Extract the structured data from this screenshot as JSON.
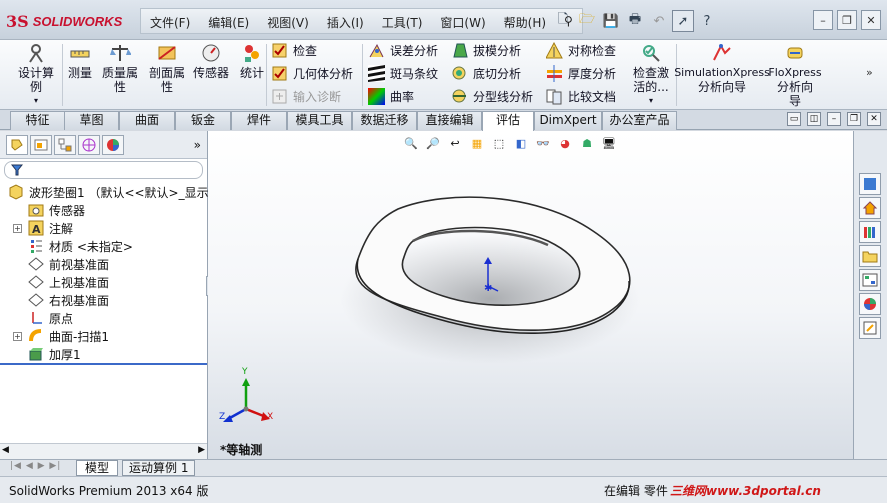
{
  "app": {
    "brand_ds": "3S",
    "brand_name": "SOLIDWORKS"
  },
  "menubar": {
    "items": [
      "文件(F)",
      "编辑(E)",
      "视图(V)",
      "插入(I)",
      "工具(T)",
      "窗口(W)",
      "帮助(H)"
    ]
  },
  "quick_access": {
    "help_symbol": "?"
  },
  "ribbon": {
    "design_study": [
      "设计算",
      "例"
    ],
    "measure": "测量",
    "mass_props": [
      "质量属",
      "性"
    ],
    "section_props": [
      "剖面属",
      "性"
    ],
    "sensor": "传感器",
    "stats": "统计",
    "check": "检查",
    "geom_analysis": "几何体分析",
    "import_diag": "输入诊断",
    "deviation": "误差分析",
    "zebra": "斑马条纹",
    "curvature": "曲率",
    "draft": "拔模分析",
    "undercut": "底切分析",
    "parting": "分型线分析",
    "symmetry": "对称检查",
    "thickness": "厚度分析",
    "compare": "比较文档",
    "check_active": [
      "检查激",
      "活的..."
    ],
    "simxpress": [
      "SimulationXpress",
      "分析向导"
    ],
    "floxpress": [
      "FloXpress",
      "分析向",
      "导"
    ]
  },
  "tabs": [
    "特征",
    "草图",
    "曲面",
    "钣金",
    "焊件",
    "模具工具",
    "数据迁移",
    "直接编辑",
    "评估",
    "DimXpert",
    "办公室产品"
  ],
  "active_tab": "评估",
  "tree": {
    "root": "波形垫圈1 （默认<<默认>_显示",
    "items": [
      "传感器",
      "注解",
      "材质 <未指定>",
      "前视基准面",
      "上视基准面",
      "右视基准面",
      "原点",
      "曲面-扫描1",
      "加厚1"
    ]
  },
  "viewport": {
    "view_label": "*等轴测",
    "triad": {
      "x": "X",
      "y": "Y",
      "z": "Z"
    }
  },
  "bottom_tabs": [
    "模型",
    "运动算例 1"
  ],
  "status": {
    "app_version": "SolidWorks Premium 2013 x64 版",
    "editing": "在编辑 零件",
    "watermark": "三维网www.3dportal.cn"
  },
  "colors": {
    "brand_red": "#c8102e",
    "active_tab_bg": "#ffffff",
    "triad_x": "#d01010",
    "triad_y": "#10a010",
    "triad_z": "#1030d0"
  }
}
